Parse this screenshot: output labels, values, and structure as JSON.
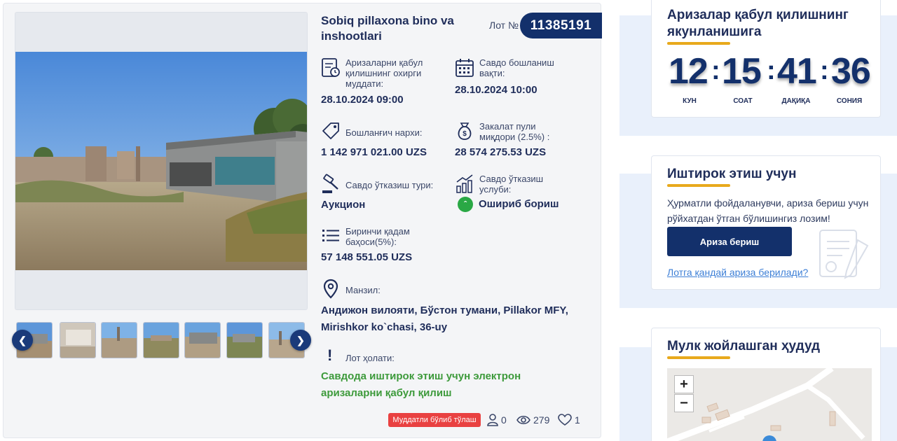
{
  "lot": {
    "title": "Sobiq pillaxona bino va inshootlari",
    "number_label": "Лот №",
    "number": "11385191"
  },
  "info": {
    "deadline_label": "Аризаларни қабул қилишнинг охирги муддати:",
    "deadline_value": "28.10.2024 09:00",
    "trade_start_label": "Савдо бошланиш вақти:",
    "trade_start_value": "28.10.2024 10:00",
    "start_price_label": "Бошланғич нархи:",
    "start_price_value": "1 142 971 021.00 UZS",
    "deposit_label": "Закалат пули миқдори (2.5%) :",
    "deposit_value": "28 574 275.53 UZS",
    "trade_type_label": "Савдо ўтказиш тури:",
    "trade_type_value": "Аукцион",
    "trade_method_label": "Савдо ўтказиш услуби:",
    "trade_method_value": "Ошириб бориш",
    "first_step_label": "Биринчи қадам баҳоси(5%):",
    "first_step_value": "57 148 551.05 UZS",
    "address_label": "Манзил:",
    "address_value": "Андижон вилояти, Бўстон тумани, Pillakor MFY, Mirishkor ko`chasi, 36-uy",
    "status_label": "Лот ҳолати:",
    "status_value": "Савдода иштирок этиш учун электрон аризаларни қабул қилиш"
  },
  "footer": {
    "installment_badge": "Муддатли бўлиб тўлаш",
    "participants": "0",
    "views": "279",
    "likes": "1"
  },
  "timer": {
    "title": "Аризалар қабул қилишнинг якунланишига",
    "days": "12",
    "hours": "15",
    "minutes": "41",
    "seconds": "36",
    "days_label": "КУН",
    "hours_label": "СОАТ",
    "minutes_label": "ДАҚИҚА",
    "seconds_label": "СОНИЯ"
  },
  "participate": {
    "title": "Иштирок этиш учун",
    "text": "Ҳурматли фойдаланувчи, ариза бериш учун рўйхатдан ўтган бўлишингиз лозим!",
    "button": "Ариза бериш",
    "link": "Лотга қандай ариза берилади?"
  },
  "region": {
    "title": "Мулк жойлашган ҳудуд",
    "zoom_in": "+",
    "zoom_out": "−"
  },
  "colors": {
    "navy": "#13306b",
    "accent_yellow": "#e8a91c",
    "status_green": "#3d9a3b",
    "badge_red": "#e94141"
  }
}
